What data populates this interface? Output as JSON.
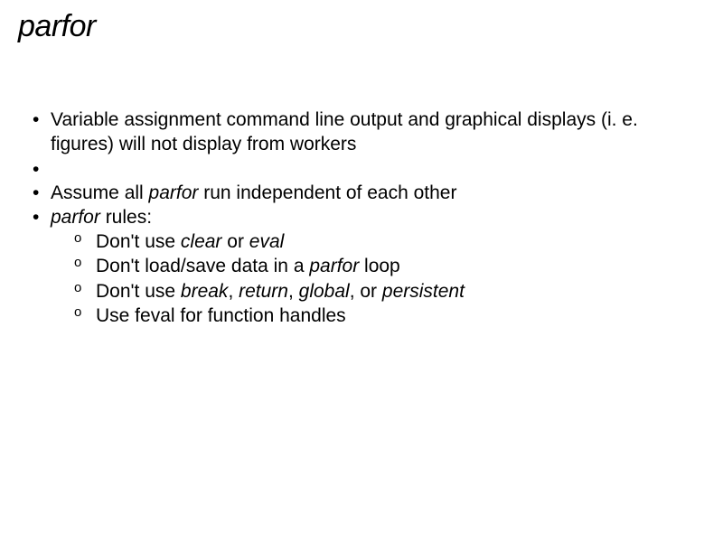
{
  "title": "parfor",
  "bullets": {
    "b1": "Variable assignment command line output and graphical displays (i. e. figures) will not display from workers",
    "b2_pre": "Assume all ",
    "b2_it": "parfor",
    "b2_post": " run independent of each other",
    "b3_it": "parfor",
    "b3_post": " rules:",
    "s1_pre": "Don't use ",
    "s1_it1": "clear",
    "s1_mid": " or ",
    "s1_it2": "eval",
    "s2_pre": "Don't load/save data in a ",
    "s2_it": "parfor",
    "s2_post": " loop",
    "s3_pre": "Don't use ",
    "s3_it1": "break",
    "s3_c1": ", ",
    "s3_it2": "return",
    "s3_c2": ", ",
    "s3_it3": "global",
    "s3_c3": ", or ",
    "s3_it4": "persistent",
    "s4": "Use feval for function handles"
  }
}
